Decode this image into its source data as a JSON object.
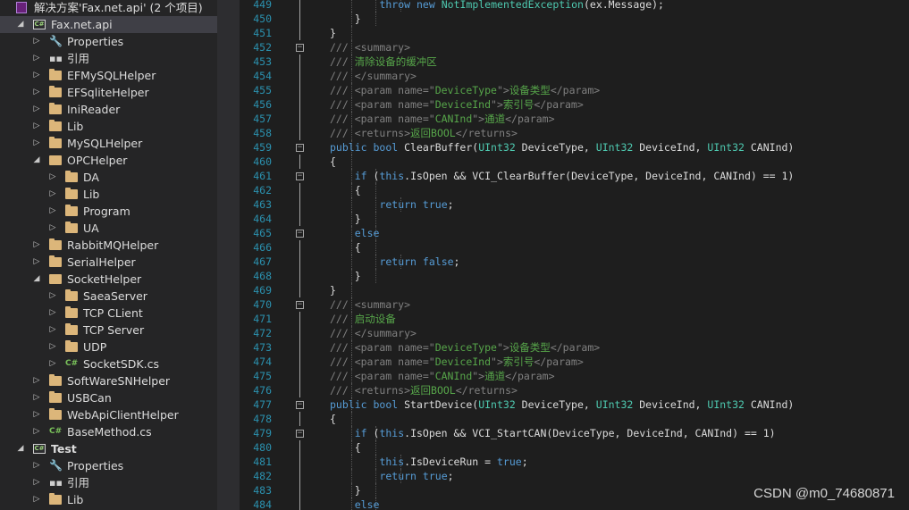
{
  "solution_explorer": {
    "items": [
      {
        "label": "解决方案'Fax.net.api' (2 个项目)",
        "level": 0,
        "icon": "solution-icon",
        "arrow": "none"
      },
      {
        "label": "Fax.net.api",
        "level": 0,
        "icon": "csharp-project-icon",
        "arrow": "expanded",
        "selected": true
      },
      {
        "label": "Properties",
        "level": 1,
        "icon": "wrench-icon",
        "arrow": "collapsed"
      },
      {
        "label": "引用",
        "level": 1,
        "icon": "references-icon",
        "arrow": "collapsed"
      },
      {
        "label": "EFMySQLHelper",
        "level": 1,
        "icon": "folder-icon",
        "arrow": "collapsed"
      },
      {
        "label": "EFSqliteHelper",
        "level": 1,
        "icon": "folder-icon",
        "arrow": "collapsed"
      },
      {
        "label": "IniReader",
        "level": 1,
        "icon": "folder-icon",
        "arrow": "collapsed"
      },
      {
        "label": "Lib",
        "level": 1,
        "icon": "folder-icon",
        "arrow": "collapsed"
      },
      {
        "label": "MySQLHelper",
        "level": 1,
        "icon": "folder-icon",
        "arrow": "collapsed"
      },
      {
        "label": "OPCHelper",
        "level": 1,
        "icon": "folder-open-icon",
        "arrow": "expanded"
      },
      {
        "label": "DA",
        "level": 2,
        "icon": "folder-icon",
        "arrow": "collapsed"
      },
      {
        "label": "Lib",
        "level": 2,
        "icon": "folder-icon",
        "arrow": "collapsed"
      },
      {
        "label": "Program",
        "level": 2,
        "icon": "folder-icon",
        "arrow": "collapsed"
      },
      {
        "label": "UA",
        "level": 2,
        "icon": "folder-icon",
        "arrow": "collapsed"
      },
      {
        "label": "RabbitMQHelper",
        "level": 1,
        "icon": "folder-icon",
        "arrow": "collapsed"
      },
      {
        "label": "SerialHelper",
        "level": 1,
        "icon": "folder-icon",
        "arrow": "collapsed"
      },
      {
        "label": "SocketHelper",
        "level": 1,
        "icon": "folder-open-icon",
        "arrow": "expanded"
      },
      {
        "label": "SaeaServer",
        "level": 2,
        "icon": "folder-icon",
        "arrow": "collapsed"
      },
      {
        "label": "TCP CLient",
        "level": 2,
        "icon": "folder-icon",
        "arrow": "collapsed"
      },
      {
        "label": "TCP Server",
        "level": 2,
        "icon": "folder-icon",
        "arrow": "collapsed"
      },
      {
        "label": "UDP",
        "level": 2,
        "icon": "folder-icon",
        "arrow": "collapsed"
      },
      {
        "label": "SocketSDK.cs",
        "level": 2,
        "icon": "csharp-file-icon",
        "arrow": "collapsed"
      },
      {
        "label": "SoftWareSNHelper",
        "level": 1,
        "icon": "folder-icon",
        "arrow": "collapsed"
      },
      {
        "label": "USBCan",
        "level": 1,
        "icon": "folder-icon",
        "arrow": "collapsed"
      },
      {
        "label": "WebApiClientHelper",
        "level": 1,
        "icon": "folder-icon",
        "arrow": "collapsed"
      },
      {
        "label": "BaseMethod.cs",
        "level": 1,
        "icon": "csharp-file-icon",
        "arrow": "collapsed"
      },
      {
        "label": "Test",
        "level": 0,
        "icon": "csharp-project-icon",
        "arrow": "expanded",
        "bold": true
      },
      {
        "label": "Properties",
        "level": 1,
        "icon": "wrench-icon",
        "arrow": "collapsed"
      },
      {
        "label": "引用",
        "level": 1,
        "icon": "references-icon",
        "arrow": "collapsed"
      },
      {
        "label": "Lib",
        "level": 1,
        "icon": "folder-icon",
        "arrow": "collapsed"
      }
    ]
  },
  "editor": {
    "lines": [
      {
        "num": "449",
        "indent": 4,
        "tokens": [
          [
            "k",
            "throw"
          ],
          [
            "p",
            " "
          ],
          [
            "k",
            "new"
          ],
          [
            "p",
            " "
          ],
          [
            "t",
            "NotImplementedException"
          ],
          [
            "p",
            "(ex.Message);"
          ]
        ]
      },
      {
        "num": "450",
        "indent": 3,
        "tokens": [
          [
            "p",
            "}"
          ]
        ]
      },
      {
        "num": "451",
        "indent": 2,
        "tokens": [
          [
            "p",
            "}"
          ]
        ]
      },
      {
        "num": "452",
        "indent": 2,
        "fold": true,
        "tokens": [
          [
            "g",
            "/// <summary>"
          ]
        ]
      },
      {
        "num": "453",
        "indent": 2,
        "tokens": [
          [
            "g",
            "/// "
          ],
          [
            "c",
            "清除设备的缓冲区"
          ]
        ]
      },
      {
        "num": "454",
        "indent": 2,
        "tokens": [
          [
            "g",
            "/// </summary>"
          ]
        ]
      },
      {
        "num": "455",
        "indent": 2,
        "tokens": [
          [
            "g",
            "/// <param name=\""
          ],
          [
            "c",
            "DeviceType"
          ],
          [
            "g",
            "\">"
          ],
          [
            "c",
            "设备类型"
          ],
          [
            "g",
            "</param>"
          ]
        ]
      },
      {
        "num": "456",
        "indent": 2,
        "tokens": [
          [
            "g",
            "/// <param name=\""
          ],
          [
            "c",
            "DeviceInd"
          ],
          [
            "g",
            "\">"
          ],
          [
            "c",
            "索引号"
          ],
          [
            "g",
            "</param>"
          ]
        ]
      },
      {
        "num": "457",
        "indent": 2,
        "tokens": [
          [
            "g",
            "/// <param name=\""
          ],
          [
            "c",
            "CANInd"
          ],
          [
            "g",
            "\">"
          ],
          [
            "c",
            "通道"
          ],
          [
            "g",
            "</param>"
          ]
        ]
      },
      {
        "num": "458",
        "indent": 2,
        "tokens": [
          [
            "g",
            "/// <returns>"
          ],
          [
            "c",
            "返回BOOL"
          ],
          [
            "g",
            "</returns>"
          ]
        ]
      },
      {
        "num": "459",
        "indent": 2,
        "fold": true,
        "tokens": [
          [
            "k",
            "public"
          ],
          [
            "p",
            " "
          ],
          [
            "k",
            "bool"
          ],
          [
            "p",
            " ClearBuffer("
          ],
          [
            "t",
            "UInt32"
          ],
          [
            "p",
            " DeviceType, "
          ],
          [
            "t",
            "UInt32"
          ],
          [
            "p",
            " DeviceInd, "
          ],
          [
            "t",
            "UInt32"
          ],
          [
            "p",
            " CANInd)"
          ]
        ]
      },
      {
        "num": "460",
        "indent": 2,
        "tokens": [
          [
            "p",
            "{"
          ]
        ]
      },
      {
        "num": "461",
        "indent": 3,
        "fold": true,
        "tokens": [
          [
            "k",
            "if"
          ],
          [
            "p",
            " ("
          ],
          [
            "k",
            "this"
          ],
          [
            "p",
            ".IsOpen && VCI_ClearBuffer(DeviceType, DeviceInd, CANInd) == 1)"
          ]
        ]
      },
      {
        "num": "462",
        "indent": 3,
        "tokens": [
          [
            "p",
            "{"
          ]
        ]
      },
      {
        "num": "463",
        "indent": 4,
        "tokens": [
          [
            "k",
            "return"
          ],
          [
            "p",
            " "
          ],
          [
            "k",
            "true"
          ],
          [
            "p",
            ";"
          ]
        ]
      },
      {
        "num": "464",
        "indent": 3,
        "tokens": [
          [
            "p",
            "}"
          ]
        ]
      },
      {
        "num": "465",
        "indent": 3,
        "fold": true,
        "tokens": [
          [
            "k",
            "else"
          ]
        ]
      },
      {
        "num": "466",
        "indent": 3,
        "tokens": [
          [
            "p",
            "{"
          ]
        ]
      },
      {
        "num": "467",
        "indent": 4,
        "tokens": [
          [
            "k",
            "return"
          ],
          [
            "p",
            " "
          ],
          [
            "k",
            "false"
          ],
          [
            "p",
            ";"
          ]
        ]
      },
      {
        "num": "468",
        "indent": 3,
        "tokens": [
          [
            "p",
            "}"
          ]
        ]
      },
      {
        "num": "469",
        "indent": 2,
        "tokens": [
          [
            "p",
            "}"
          ]
        ]
      },
      {
        "num": "470",
        "indent": 2,
        "fold": true,
        "tokens": [
          [
            "g",
            "/// <summary>"
          ]
        ]
      },
      {
        "num": "471",
        "indent": 2,
        "tokens": [
          [
            "g",
            "/// "
          ],
          [
            "c",
            "启动设备"
          ]
        ]
      },
      {
        "num": "472",
        "indent": 2,
        "tokens": [
          [
            "g",
            "/// </summary>"
          ]
        ]
      },
      {
        "num": "473",
        "indent": 2,
        "tokens": [
          [
            "g",
            "/// <param name=\""
          ],
          [
            "c",
            "DeviceType"
          ],
          [
            "g",
            "\">"
          ],
          [
            "c",
            "设备类型"
          ],
          [
            "g",
            "</param>"
          ]
        ]
      },
      {
        "num": "474",
        "indent": 2,
        "tokens": [
          [
            "g",
            "/// <param name=\""
          ],
          [
            "c",
            "DeviceInd"
          ],
          [
            "g",
            "\">"
          ],
          [
            "c",
            "索引号"
          ],
          [
            "g",
            "</param>"
          ]
        ]
      },
      {
        "num": "475",
        "indent": 2,
        "tokens": [
          [
            "g",
            "/// <param name=\""
          ],
          [
            "c",
            "CANInd"
          ],
          [
            "g",
            "\">"
          ],
          [
            "c",
            "通道"
          ],
          [
            "g",
            "</param>"
          ]
        ]
      },
      {
        "num": "476",
        "indent": 2,
        "tokens": [
          [
            "g",
            "/// <returns>"
          ],
          [
            "c",
            "返回BOOL"
          ],
          [
            "g",
            "</returns>"
          ]
        ]
      },
      {
        "num": "477",
        "indent": 2,
        "fold": true,
        "tokens": [
          [
            "k",
            "public"
          ],
          [
            "p",
            " "
          ],
          [
            "k",
            "bool"
          ],
          [
            "p",
            " StartDevice("
          ],
          [
            "t",
            "UInt32"
          ],
          [
            "p",
            " DeviceType, "
          ],
          [
            "t",
            "UInt32"
          ],
          [
            "p",
            " DeviceInd, "
          ],
          [
            "t",
            "UInt32"
          ],
          [
            "p",
            " CANInd)"
          ]
        ]
      },
      {
        "num": "478",
        "indent": 2,
        "tokens": [
          [
            "p",
            "{"
          ]
        ]
      },
      {
        "num": "479",
        "indent": 3,
        "fold": true,
        "tokens": [
          [
            "k",
            "if"
          ],
          [
            "p",
            " ("
          ],
          [
            "k",
            "this"
          ],
          [
            "p",
            ".IsOpen && VCI_StartCAN(DeviceType, DeviceInd, CANInd) == 1)"
          ]
        ]
      },
      {
        "num": "480",
        "indent": 3,
        "tokens": [
          [
            "p",
            "{"
          ]
        ]
      },
      {
        "num": "481",
        "indent": 4,
        "tokens": [
          [
            "k",
            "this"
          ],
          [
            "p",
            ".IsDeviceRun = "
          ],
          [
            "k",
            "true"
          ],
          [
            "p",
            ";"
          ]
        ]
      },
      {
        "num": "482",
        "indent": 4,
        "tokens": [
          [
            "k",
            "return"
          ],
          [
            "p",
            " "
          ],
          [
            "k",
            "true"
          ],
          [
            "p",
            ";"
          ]
        ]
      },
      {
        "num": "483",
        "indent": 3,
        "tokens": [
          [
            "p",
            "}"
          ]
        ]
      },
      {
        "num": "484",
        "indent": 3,
        "tokens": [
          [
            "k",
            "else"
          ]
        ]
      }
    ]
  },
  "watermark": "CSDN @m0_74680871"
}
